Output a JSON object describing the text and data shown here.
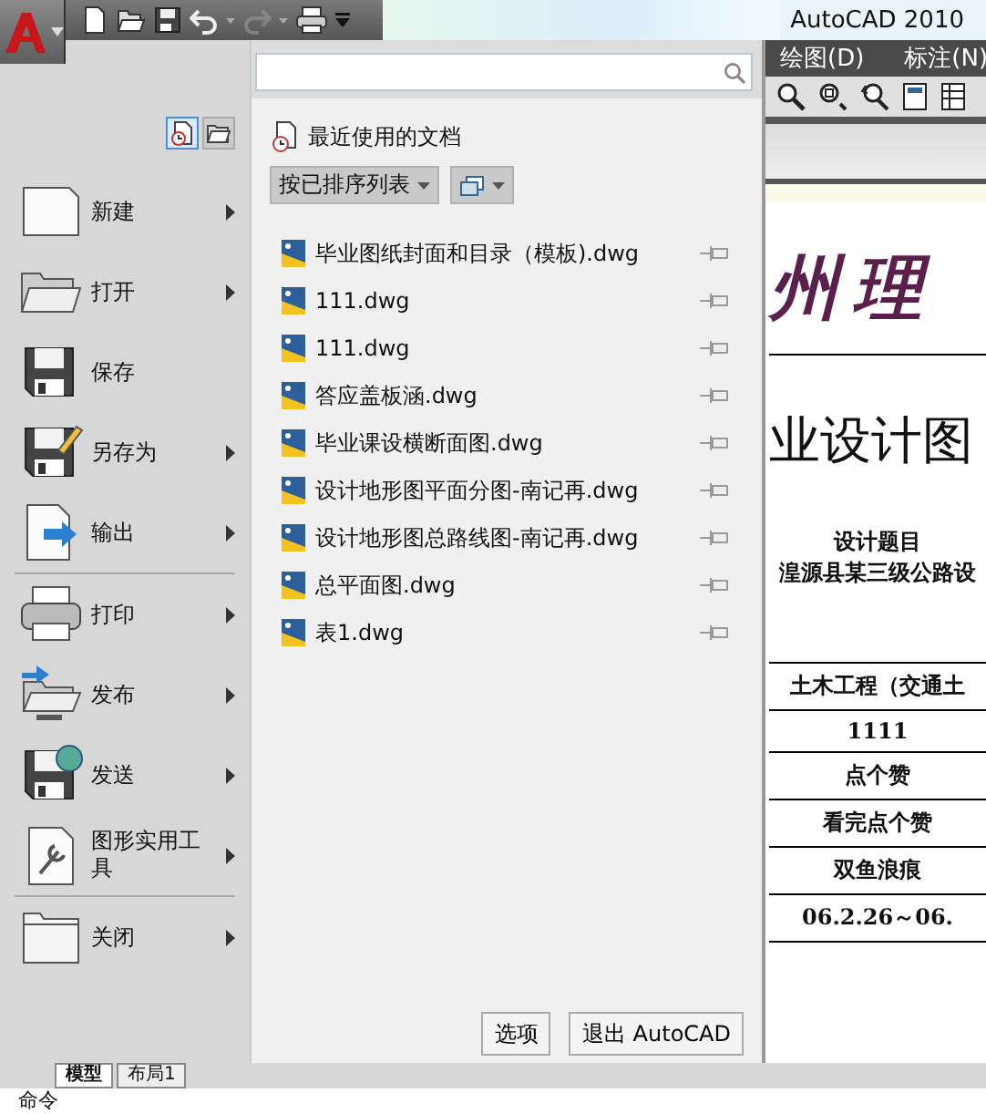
{
  "title_bar": {
    "title": "AutoCAD 2010"
  },
  "quick_access": [
    {
      "kind": "new",
      "disabled": false
    },
    {
      "kind": "open",
      "disabled": false
    },
    {
      "kind": "save",
      "disabled": false
    },
    {
      "kind": "undo",
      "disabled": false
    },
    {
      "kind": "redo",
      "disabled": true
    },
    {
      "kind": "plot",
      "disabled": false
    }
  ],
  "view_toggles": [
    {
      "kind": "recent",
      "selected": true
    },
    {
      "kind": "open",
      "selected": false
    }
  ],
  "menu_groups": [
    [
      {
        "label": "新建",
        "kind": "new",
        "has_submenu": true
      },
      {
        "label": "打开",
        "kind": "open",
        "has_submenu": true
      },
      {
        "label": "保存",
        "kind": "save",
        "has_submenu": false
      },
      {
        "label": "另存为",
        "kind": "saveas",
        "has_submenu": true
      },
      {
        "label": "输出",
        "kind": "export",
        "has_submenu": true
      }
    ],
    [
      {
        "label": "打印",
        "kind": "plot",
        "has_submenu": true
      },
      {
        "label": "发布",
        "kind": "publish",
        "has_submenu": true
      },
      {
        "label": "发送",
        "kind": "send",
        "has_submenu": true
      },
      {
        "label": "图形实用工具",
        "kind": "utilities",
        "has_submenu": true
      }
    ],
    [
      {
        "label": "关闭",
        "kind": "close",
        "has_submenu": true
      }
    ]
  ],
  "recent": {
    "heading": "最近使用的文档",
    "sort": "按已排序列表",
    "files": [
      {
        "name": "毕业图纸封面和目录（模板).dwg",
        "pinned": false
      },
      {
        "name": "111.dwg",
        "pinned": false
      },
      {
        "name": "111.dwg",
        "pinned": false
      },
      {
        "name": "答应盖板涵.dwg",
        "pinned": false
      },
      {
        "name": "毕业课设横断面图.dwg",
        "pinned": false
      },
      {
        "name": "设计地形图平面分图-南记再.dwg",
        "pinned": false
      },
      {
        "name": "设计地形图总路线图-南记再.dwg",
        "pinned": false
      },
      {
        "name": "总平面图.dwg",
        "pinned": false
      },
      {
        "name": "表1.dwg",
        "pinned": false
      }
    ]
  },
  "buttons": [
    "选项",
    "退出 AutoCAD"
  ],
  "drawing": {
    "menus": [
      "绘图(D)",
      "标注(N)"
    ],
    "texts": [
      {
        "text": "州理",
        "kind": "calligraphy"
      },
      {
        "text": "业设计图",
        "kind": "title"
      },
      {
        "text": "设计题目",
        "kind": "bold"
      },
      {
        "text": "湟源县某三级公路设",
        "kind": "bold"
      },
      {
        "text": "土木工程（交通土",
        "kind": "cell"
      },
      {
        "text": "1111",
        "kind": "cell"
      },
      {
        "text": "点个赞",
        "kind": "cell"
      },
      {
        "text": "看完点个赞",
        "kind": "cell"
      },
      {
        "text": "双鱼浪痕",
        "kind": "cell"
      },
      {
        "text": "06.2.26～06.",
        "kind": "cell"
      }
    ]
  },
  "layout_tabs": [
    {
      "label": "模型",
      "selected": true
    },
    {
      "label": "布局1",
      "selected": false
    }
  ],
  "command_line": "命令"
}
